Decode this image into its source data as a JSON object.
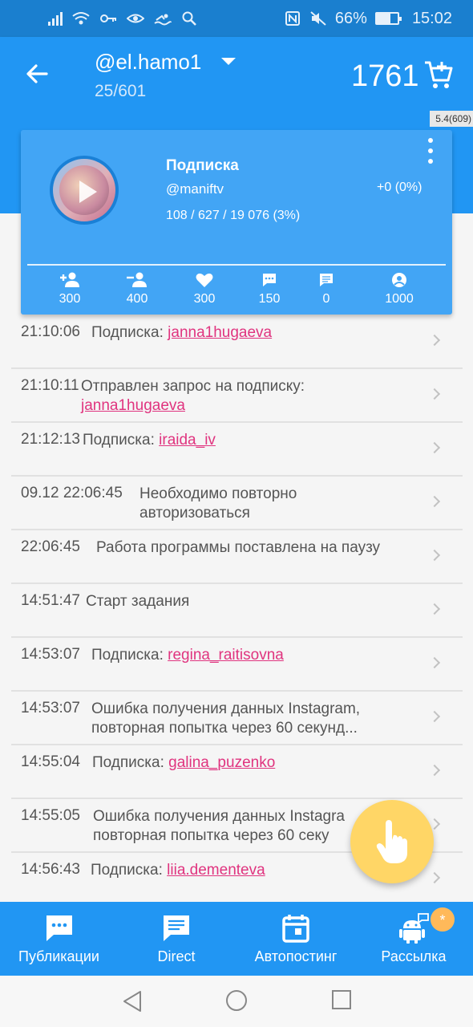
{
  "status_bar": {
    "battery": "66%",
    "battery_level": 0.66,
    "time": "15:02"
  },
  "app_bar": {
    "account": "@el.hamo1",
    "account_progress": "25/601",
    "balance": "1761",
    "version": "5.4(609)"
  },
  "task_card": {
    "title": "Подписка",
    "username": "@maniftv",
    "stats": "108 / 627 / 19 076 (3%)",
    "delta": "+0 (0%)",
    "limits": [
      {
        "icon": "follow-icon",
        "value": "300"
      },
      {
        "icon": "unfollow-icon",
        "value": "400"
      },
      {
        "icon": "like-icon",
        "value": "300"
      },
      {
        "icon": "comment-icon",
        "value": "150"
      },
      {
        "icon": "direct-message-icon",
        "value": "0"
      },
      {
        "icon": "view-stories-icon",
        "value": "1000"
      }
    ]
  },
  "log": [
    {
      "time": "21:10:06",
      "text": "Подписка: ",
      "link": "janna1hugaeva"
    },
    {
      "time": "21:10:11",
      "text": "Отправлен запрос на подписку:",
      "link": "janna1hugaeva"
    },
    {
      "time": "21:12:13",
      "text": "Подписка: ",
      "link": "iraida_iv"
    },
    {
      "time": "09.12 22:06:45",
      "text": "Необходимо повторно",
      "text2": "авторизоваться"
    },
    {
      "time": "22:06:45",
      "text": "Работа программы поставлена на паузу"
    },
    {
      "time": "14:51:47",
      "text": "Старт задания"
    },
    {
      "time": "14:53:07",
      "text": "Подписка: ",
      "link": "regina_raitisovna"
    },
    {
      "time": "14:53:07",
      "text": "Ошибка получения данных Instagram,",
      "text2": "повторная попытка через 60 секунд..."
    },
    {
      "time": "14:55:04",
      "text": "Подписка: ",
      "link": "galina_puzenko"
    },
    {
      "time": "14:55:05",
      "text": "Ошибка получения данных Instagra",
      "text2": "повторная попытка через 60 секу"
    },
    {
      "time": "14:56:43",
      "text": "Подписка: ",
      "link": "liia.dementeva"
    }
  ],
  "bottom_nav": {
    "tabs": [
      {
        "label": "Публикации",
        "icon": "publications-icon"
      },
      {
        "label": "Direct",
        "icon": "direct-icon"
      },
      {
        "label": "Автопостинг",
        "icon": "calendar-icon"
      },
      {
        "label": "Рассылка",
        "icon": "android-broadcast-icon"
      }
    ],
    "badge": "*"
  },
  "colors": {
    "primary": "#2196f3",
    "card": "#42a5f5",
    "link": "#e0347f",
    "fab": "#ffd666"
  }
}
